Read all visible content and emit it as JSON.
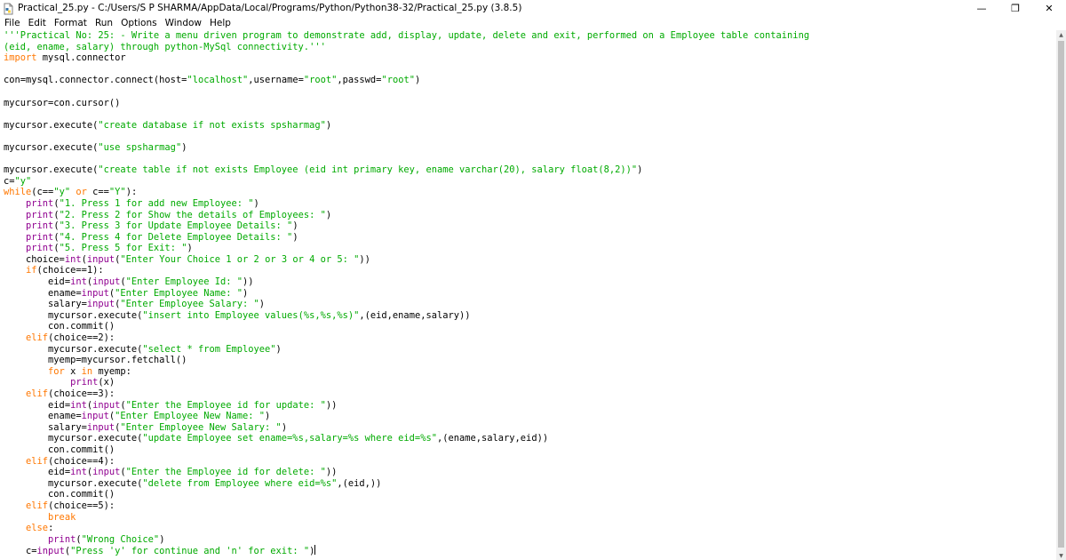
{
  "window": {
    "title": "Practical_25.py - C:/Users/S P SHARMA/AppData/Local/Programs/Python/Python38-32/Practical_25.py (3.8.5)",
    "minimize": "—",
    "maximize": "❐",
    "close": "✕"
  },
  "menu": [
    "File",
    "Edit",
    "Format",
    "Run",
    "Options",
    "Window",
    "Help"
  ],
  "colors": {
    "keyword": "#ff7700",
    "builtin": "#900090",
    "string": "#00aa00",
    "text": "#000000"
  },
  "code_lines": [
    [
      [
        "st",
        "'''Practical No: 25: - Write a menu driven program to demonstrate add, display, update, delete and exit, performed on a Employee table containing"
      ]
    ],
    [
      [
        "st",
        "(eid, ename, salary) through python-MySql connectivity.'''"
      ]
    ],
    [
      [
        "kw",
        "import"
      ],
      [
        "",
        " mysql.connector"
      ]
    ],
    [],
    [
      [
        "",
        "con=mysql.connector.connect(host="
      ],
      [
        "st",
        "\"localhost\""
      ],
      [
        "",
        ",username="
      ],
      [
        "st",
        "\"root\""
      ],
      [
        "",
        ",passwd="
      ],
      [
        "st",
        "\"root\""
      ],
      [
        "",
        ")"
      ]
    ],
    [],
    [
      [
        "",
        "mycursor=con.cursor()"
      ]
    ],
    [],
    [
      [
        "",
        "mycursor.execute("
      ],
      [
        "st",
        "\"create database if not exists spsharmag\""
      ],
      [
        "",
        ")"
      ]
    ],
    [],
    [
      [
        "",
        "mycursor.execute("
      ],
      [
        "st",
        "\"use spsharmag\""
      ],
      [
        "",
        ")"
      ]
    ],
    [],
    [
      [
        "",
        "mycursor.execute("
      ],
      [
        "st",
        "\"create table if not exists Employee (eid int primary key, ename varchar(20), salary float(8,2))\""
      ],
      [
        "",
        ")"
      ]
    ],
    [
      [
        "",
        "c="
      ],
      [
        "st",
        "\"y\""
      ]
    ],
    [
      [
        "kw",
        "while"
      ],
      [
        "",
        "(c=="
      ],
      [
        "st",
        "\"y\""
      ],
      [
        "",
        " "
      ],
      [
        "kw",
        "or"
      ],
      [
        "",
        " c=="
      ],
      [
        "st",
        "\"Y\""
      ],
      [
        "",
        "):"
      ]
    ],
    [
      [
        "",
        "    "
      ],
      [
        "bi",
        "print"
      ],
      [
        "",
        "("
      ],
      [
        "st",
        "\"1. Press 1 for add new Employee: \""
      ],
      [
        "",
        ")"
      ]
    ],
    [
      [
        "",
        "    "
      ],
      [
        "bi",
        "print"
      ],
      [
        "",
        "("
      ],
      [
        "st",
        "\"2. Press 2 for Show the details of Employees: \""
      ],
      [
        "",
        ")"
      ]
    ],
    [
      [
        "",
        "    "
      ],
      [
        "bi",
        "print"
      ],
      [
        "",
        "("
      ],
      [
        "st",
        "\"3. Press 3 for Update Employee Details: \""
      ],
      [
        "",
        ")"
      ]
    ],
    [
      [
        "",
        "    "
      ],
      [
        "bi",
        "print"
      ],
      [
        "",
        "("
      ],
      [
        "st",
        "\"4. Press 4 for Delete Employee Details: \""
      ],
      [
        "",
        ")"
      ]
    ],
    [
      [
        "",
        "    "
      ],
      [
        "bi",
        "print"
      ],
      [
        "",
        "("
      ],
      [
        "st",
        "\"5. Press 5 for Exit: \""
      ],
      [
        "",
        ")"
      ]
    ],
    [
      [
        "",
        "    choice="
      ],
      [
        "bi",
        "int"
      ],
      [
        "",
        "("
      ],
      [
        "bi",
        "input"
      ],
      [
        "",
        "("
      ],
      [
        "st",
        "\"Enter Your Choice 1 or 2 or 3 or 4 or 5: \""
      ],
      [
        "",
        "))"
      ]
    ],
    [
      [
        "",
        "    "
      ],
      [
        "kw",
        "if"
      ],
      [
        "",
        "(choice==1):"
      ]
    ],
    [
      [
        "",
        "        eid="
      ],
      [
        "bi",
        "int"
      ],
      [
        "",
        "("
      ],
      [
        "bi",
        "input"
      ],
      [
        "",
        "("
      ],
      [
        "st",
        "\"Enter Employee Id: \""
      ],
      [
        "",
        "))"
      ]
    ],
    [
      [
        "",
        "        ename="
      ],
      [
        "bi",
        "input"
      ],
      [
        "",
        "("
      ],
      [
        "st",
        "\"Enter Employee Name: \""
      ],
      [
        "",
        ")"
      ]
    ],
    [
      [
        "",
        "        salary="
      ],
      [
        "bi",
        "input"
      ],
      [
        "",
        "("
      ],
      [
        "st",
        "\"Enter Employee Salary: \""
      ],
      [
        "",
        ")"
      ]
    ],
    [
      [
        "",
        "        mycursor.execute("
      ],
      [
        "st",
        "\"insert into Employee values(%s,%s,%s)\""
      ],
      [
        "",
        ",(eid,ename,salary))"
      ]
    ],
    [
      [
        "",
        "        con.commit()"
      ]
    ],
    [
      [
        "",
        "    "
      ],
      [
        "kw",
        "elif"
      ],
      [
        "",
        "(choice==2):"
      ]
    ],
    [
      [
        "",
        "        mycursor.execute("
      ],
      [
        "st",
        "\"select * from Employee\""
      ],
      [
        "",
        ")"
      ]
    ],
    [
      [
        "",
        "        myemp=mycursor.fetchall()"
      ]
    ],
    [
      [
        "",
        "        "
      ],
      [
        "kw",
        "for"
      ],
      [
        "",
        " x "
      ],
      [
        "kw",
        "in"
      ],
      [
        "",
        " myemp:"
      ]
    ],
    [
      [
        "",
        "            "
      ],
      [
        "bi",
        "print"
      ],
      [
        "",
        "(x)"
      ]
    ],
    [
      [
        "",
        "    "
      ],
      [
        "kw",
        "elif"
      ],
      [
        "",
        "(choice==3):"
      ]
    ],
    [
      [
        "",
        "        eid="
      ],
      [
        "bi",
        "int"
      ],
      [
        "",
        "("
      ],
      [
        "bi",
        "input"
      ],
      [
        "",
        "("
      ],
      [
        "st",
        "\"Enter the Employee id for update: \""
      ],
      [
        "",
        "))"
      ]
    ],
    [
      [
        "",
        "        ename="
      ],
      [
        "bi",
        "input"
      ],
      [
        "",
        "("
      ],
      [
        "st",
        "\"Enter Employee New Name: \""
      ],
      [
        "",
        ")"
      ]
    ],
    [
      [
        "",
        "        salary="
      ],
      [
        "bi",
        "input"
      ],
      [
        "",
        "("
      ],
      [
        "st",
        "\"Enter Employee New Salary: \""
      ],
      [
        "",
        ")"
      ]
    ],
    [
      [
        "",
        "        mycursor.execute("
      ],
      [
        "st",
        "\"update Employee set ename=%s,salary=%s where eid=%s\""
      ],
      [
        "",
        ",(ename,salary,eid))"
      ]
    ],
    [
      [
        "",
        "        con.commit()"
      ]
    ],
    [
      [
        "",
        "    "
      ],
      [
        "kw",
        "elif"
      ],
      [
        "",
        "(choice==4):"
      ]
    ],
    [
      [
        "",
        "        eid="
      ],
      [
        "bi",
        "int"
      ],
      [
        "",
        "("
      ],
      [
        "bi",
        "input"
      ],
      [
        "",
        "("
      ],
      [
        "st",
        "\"Enter the Employee id for delete: \""
      ],
      [
        "",
        "))"
      ]
    ],
    [
      [
        "",
        "        mycursor.execute("
      ],
      [
        "st",
        "\"delete from Employee where eid=%s\""
      ],
      [
        "",
        ",(eid,))"
      ]
    ],
    [
      [
        "",
        "        con.commit()"
      ]
    ],
    [
      [
        "",
        "    "
      ],
      [
        "kw",
        "elif"
      ],
      [
        "",
        "(choice==5):"
      ]
    ],
    [
      [
        "",
        "        "
      ],
      [
        "kw",
        "break"
      ]
    ],
    [
      [
        "",
        "    "
      ],
      [
        "kw",
        "else"
      ],
      [
        "",
        ":"
      ]
    ],
    [
      [
        "",
        "        "
      ],
      [
        "bi",
        "print"
      ],
      [
        "",
        "("
      ],
      [
        "st",
        "\"Wrong Choice\""
      ],
      [
        "",
        ")"
      ]
    ],
    [
      [
        "",
        "    c="
      ],
      [
        "bi",
        "input"
      ],
      [
        "",
        "("
      ],
      [
        "st",
        "\"Press 'y' for continue and 'n' for exit: \""
      ],
      [
        "",
        ")"
      ]
    ]
  ]
}
